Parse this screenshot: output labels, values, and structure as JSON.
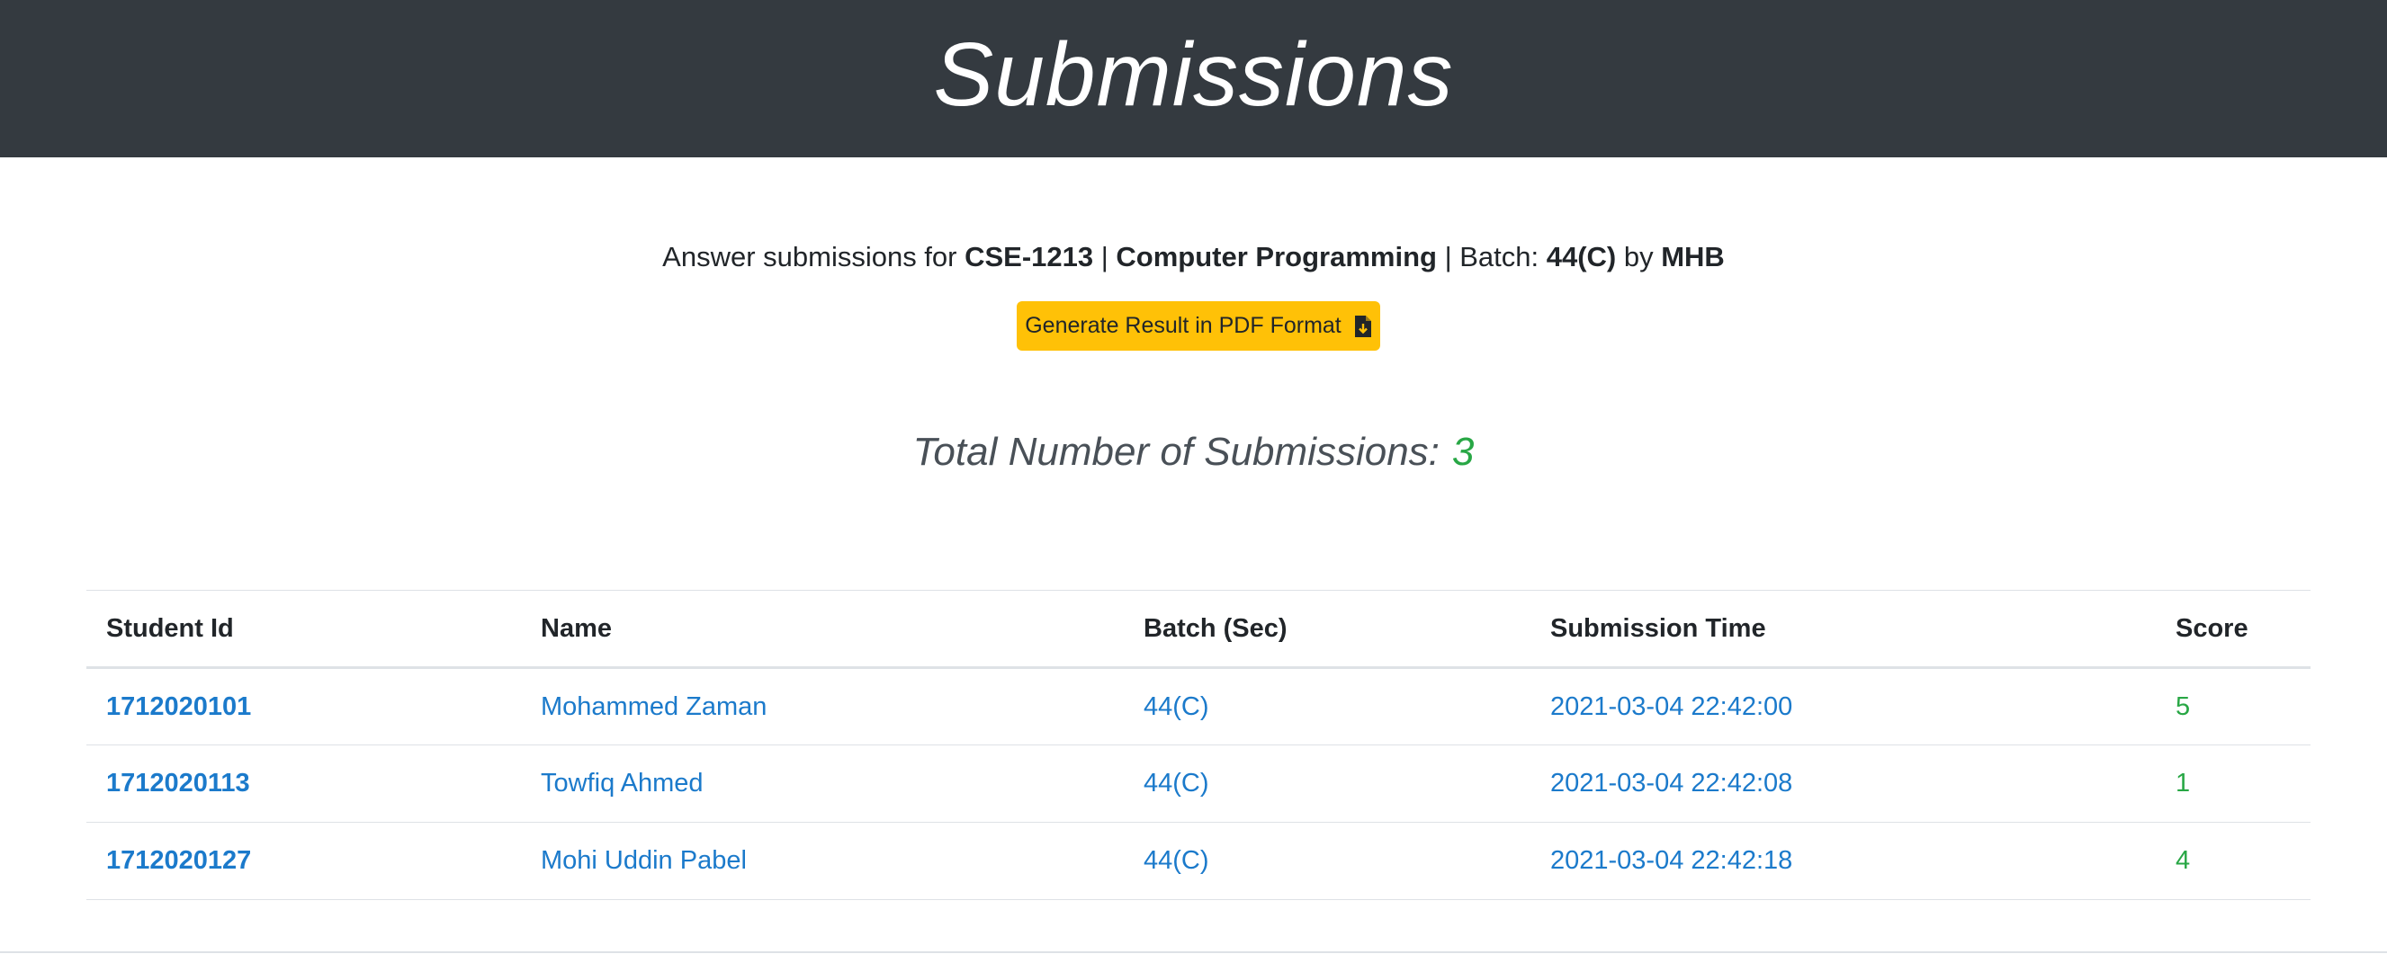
{
  "header": {
    "title": "Submissions"
  },
  "info": {
    "prefix": "Answer submissions for ",
    "course_code": "CSE-1213",
    "sep1": " | ",
    "course_name": "Computer Programming",
    "batch_prefix": " | Batch: ",
    "batch": "44(C)",
    "by_text": " by ",
    "teacher": "MHB"
  },
  "actions": {
    "generate_pdf_label": "Generate Result in PDF Format",
    "generate_pdf_icon": "file-download-icon"
  },
  "summary": {
    "total_label": "Total Number of Submissions:",
    "total_count": "3"
  },
  "table": {
    "columns": [
      "Student Id",
      "Name",
      "Batch (Sec)",
      "Submission Time",
      "Score"
    ],
    "rows": [
      {
        "student_id": "1712020101",
        "name": "Mohammed Zaman",
        "batch": "44(C)",
        "time": "2021-03-04 22:42:00",
        "score": "5"
      },
      {
        "student_id": "1712020113",
        "name": "Towfiq Ahmed",
        "batch": "44(C)",
        "time": "2021-03-04 22:42:08",
        "score": "1"
      },
      {
        "student_id": "1712020127",
        "name": "Mohi Uddin Pabel",
        "batch": "44(C)",
        "time": "2021-03-04 22:42:18",
        "score": "4"
      }
    ]
  },
  "colors": {
    "header_bg": "#343a40",
    "button_bg": "#ffc107",
    "link": "#1b7acb",
    "success": "#28a745"
  }
}
